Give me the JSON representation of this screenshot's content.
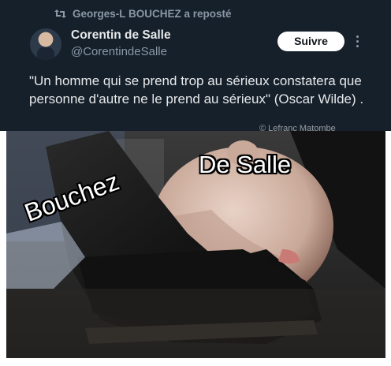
{
  "tweet": {
    "repost_label": "Georges-L BOUCHEZ a reposté",
    "author_name": "Corentin de Salle",
    "author_handle": "@CorentindeSalle",
    "follow_label": "Suivre",
    "text": "\"Un homme qui se prend trop au sérieux constatera que personne d'autre ne le prend au sérieux\" (Oscar Wilde) ."
  },
  "image": {
    "watermark": "© Lefranc Matombe",
    "caption_top": "De Salle",
    "caption_left": "Bouchez"
  },
  "icons": {
    "repost": "repost-icon",
    "more": "more-options-icon",
    "avatar": "avatar"
  },
  "colors": {
    "tweet_background": "#15202b",
    "primary_text": "#e7e9ea",
    "secondary_text": "#8b98a5",
    "follow_button_bg": "#ffffff"
  }
}
